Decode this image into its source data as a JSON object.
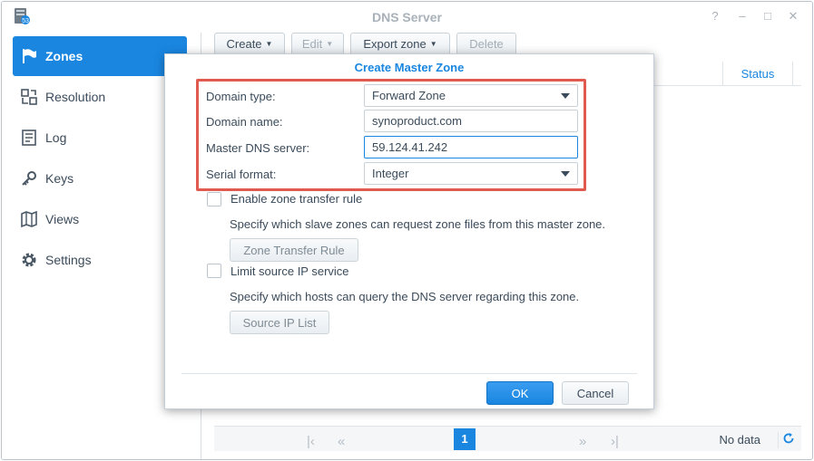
{
  "window": {
    "title": "DNS Server",
    "controls": [
      "?",
      "–",
      "□",
      "✕"
    ]
  },
  "sidebar": {
    "items": [
      {
        "label": "Zones",
        "icon": "flag-icon",
        "active": true
      },
      {
        "label": "Resolution",
        "icon": "resolution-icon",
        "active": false
      },
      {
        "label": "Log",
        "icon": "log-icon",
        "active": false
      },
      {
        "label": "Keys",
        "icon": "key-icon",
        "active": false
      },
      {
        "label": "Views",
        "icon": "views-icon",
        "active": false
      },
      {
        "label": "Settings",
        "icon": "gear-icon",
        "active": false
      }
    ]
  },
  "toolbar": {
    "create": "Create",
    "edit": "Edit",
    "export_zone": "Export zone",
    "delete": "Delete"
  },
  "grid": {
    "status_header": "Status"
  },
  "pager": {
    "current_page": "1",
    "status": "No data"
  },
  "dialog": {
    "title": "Create Master Zone",
    "fields": {
      "domain_type_label": "Domain type:",
      "domain_type_value": "Forward Zone",
      "domain_name_label": "Domain name:",
      "domain_name_value": "synoproduct.com",
      "master_dns_label": "Master DNS server:",
      "master_dns_value": "59.124.41.242",
      "serial_format_label": "Serial format:",
      "serial_format_value": "Integer"
    },
    "zone_transfer": {
      "checkbox_label": "Enable zone transfer rule",
      "description": "Specify which slave zones can request zone files from this master zone.",
      "button": "Zone Transfer Rule"
    },
    "source_ip": {
      "checkbox_label": "Limit source IP service",
      "description": "Specify which hosts can query the DNS server regarding this zone.",
      "button": "Source IP List"
    },
    "ok": "OK",
    "cancel": "Cancel"
  },
  "colors": {
    "accent": "#1a86e0",
    "highlight_border": "#e05a50"
  }
}
